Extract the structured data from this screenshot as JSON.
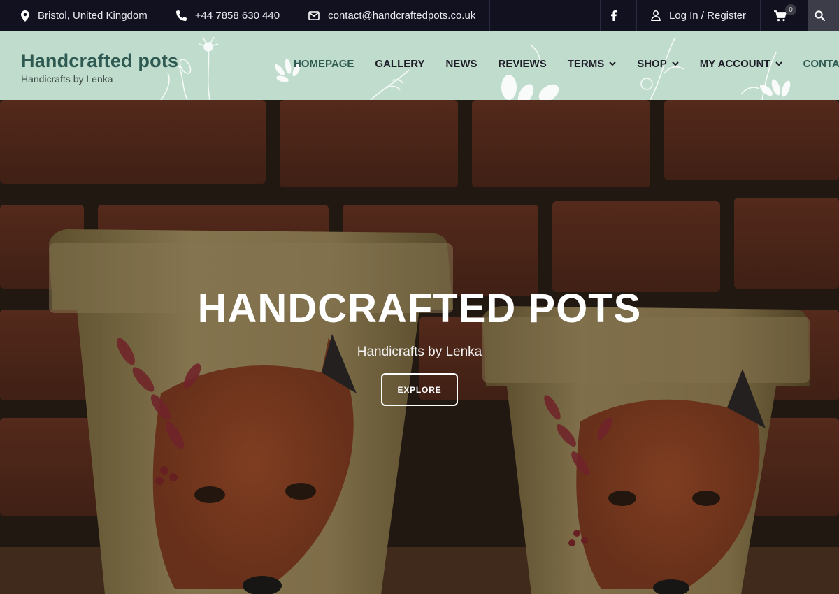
{
  "topbar": {
    "location": "Bristol, United Kingdom",
    "phone": "+44 7858 630 440",
    "email": "contact@handcraftedpots.co.uk",
    "login": "Log In / Register",
    "cart_count": "0",
    "icons": [
      "map-pin-icon",
      "phone-icon",
      "envelope-icon",
      "facebook-icon",
      "user-icon",
      "cart-icon",
      "search-icon"
    ]
  },
  "header": {
    "site_title": "Handcrafted pots",
    "tagline": "Handicrafts by Lenka",
    "nav": {
      "homepage": "HOMEPAGE",
      "gallery": "GALLERY",
      "news": "NEWS",
      "reviews": "REVIEWS",
      "terms": "TERMS",
      "shop": "SHOP",
      "my_account": "MY ACCOUNT",
      "contact": "CONTACT"
    }
  },
  "hero": {
    "title": "HANDCRAFTED POTS",
    "subtitle": "Handicrafts by Lenka",
    "button": "EXPLORE"
  },
  "colors": {
    "topbar_bg": "#12111f",
    "header_bg": "#bfdccd",
    "brand_teal": "#2f5a52",
    "nav_text": "#1e1e28"
  }
}
